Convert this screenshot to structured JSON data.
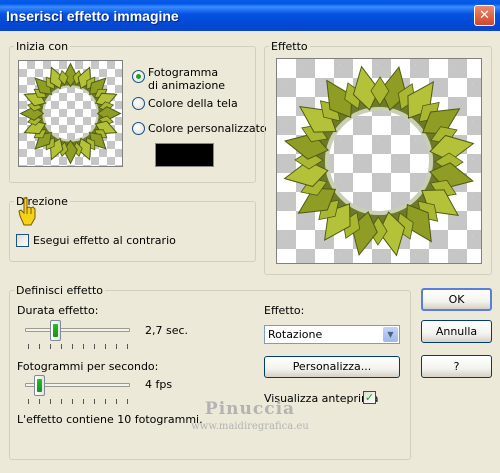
{
  "window": {
    "title": "Inserisci effetto immagine",
    "close_glyph": "✕"
  },
  "start": {
    "legend": "Inizia con",
    "options": {
      "animation_frame": "Fotogramma\ndi animazione",
      "canvas_color": "Colore della tela",
      "custom_color": "Colore personalizzato"
    },
    "selected": "animation_frame",
    "custom_color_value": "#000000"
  },
  "preview": {
    "legend": "Effetto"
  },
  "direction": {
    "legend": "Direzione",
    "reverse_label": "Esegui effetto al contrario",
    "reverse_checked": false
  },
  "define": {
    "legend": "Definisci effetto",
    "duration_label": "Durata effetto:",
    "duration_value": "2,7 sec.",
    "duration_fraction": 0.27,
    "fps_label": "Fotogrammi per secondo:",
    "fps_value": "4 fps",
    "fps_fraction": 0.1,
    "info": "L'effetto contiene 10 fotogrammi.",
    "effect_label": "Effetto:",
    "effect_selected": "Rotazione",
    "customize_button": "Personalizza...",
    "show_preview_label": "Visualizza anteprima",
    "show_preview_checked": true
  },
  "buttons": {
    "ok": "OK",
    "cancel": "Annulla",
    "help": "?"
  },
  "watermark": {
    "name": "Pinuccia",
    "url": "www.maidiregrafica.eu"
  },
  "colors": {
    "leaf_light": "#b4c23a",
    "leaf_dark": "#4f5a12",
    "titlebar": "#0553e1"
  }
}
